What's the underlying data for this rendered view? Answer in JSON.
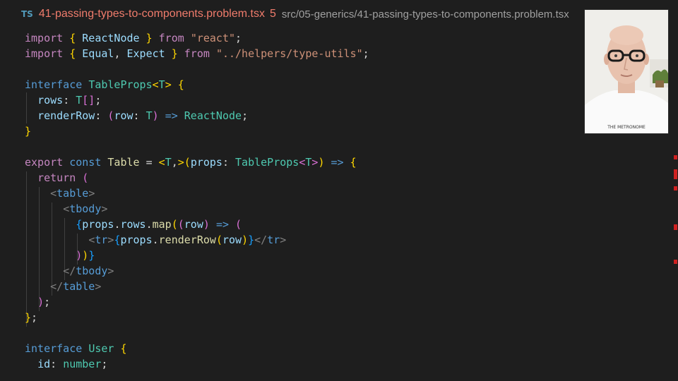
{
  "tab": {
    "language_badge": "TS",
    "filename": "41-passing-types-to-components.problem.tsx",
    "problem_count": "5",
    "path": "src/05-generics/41-passing-types-to-components.problem.tsx"
  },
  "code": {
    "l1": {
      "a": "import",
      "b": "{",
      "c": "ReactNode",
      "d": "}",
      "e": "from",
      "f": "\"react\"",
      "g": ";"
    },
    "l2": {
      "a": "import",
      "b": "{",
      "c": "Equal",
      "d": ",",
      "e": "Expect",
      "f": "}",
      "g": "from",
      "h": "\"../helpers/type-utils\"",
      "i": ";"
    },
    "l4": {
      "a": "interface",
      "b": "TableProps",
      "c": "<",
      "d": "T",
      "e": ">",
      "f": "{"
    },
    "l5": {
      "a": "rows",
      "b": ":",
      "c": "T",
      "d": "[]",
      "e": ";"
    },
    "l6": {
      "a": "renderRow",
      "b": ":",
      "c": "(",
      "d": "row",
      "e": ":",
      "f": "T",
      "g": ")",
      "h": "=>",
      "i": "ReactNode",
      "j": ";"
    },
    "l7": {
      "a": "}"
    },
    "l9": {
      "a": "export",
      "b": "const",
      "c": "Table",
      "d": "=",
      "e": "<",
      "f": "T",
      "g": ",",
      "h": ">",
      "i": "(",
      "j": "props",
      "k": ":",
      "l": "TableProps",
      "m": "<",
      "n": "T",
      "o": ">",
      "p": ")",
      "q": "=>",
      "r": "{"
    },
    "l10": {
      "a": "return",
      "b": "("
    },
    "l11": {
      "a": "<",
      "b": "table",
      "c": ">"
    },
    "l12": {
      "a": "<",
      "b": "tbody",
      "c": ">"
    },
    "l13": {
      "a": "{",
      "b": "props",
      "c": ".",
      "d": "rows",
      "e": ".",
      "f": "map",
      "g": "(",
      "h": "(",
      "i": "row",
      "j": ")",
      "k": "=>",
      "l": "("
    },
    "l14": {
      "a": "<",
      "b": "tr",
      "c": ">",
      "d": "{",
      "e": "props",
      "f": ".",
      "g": "renderRow",
      "h": "(",
      "i": "row",
      "j": ")",
      "k": "}",
      "l": "</",
      "m": "tr",
      "n": ">"
    },
    "l15": {
      "a": ")",
      "b": ")",
      "c": "}"
    },
    "l16": {
      "a": "</",
      "b": "tbody",
      "c": ">"
    },
    "l17": {
      "a": "</",
      "b": "table",
      "c": ">"
    },
    "l18": {
      "a": ")",
      "b": ";"
    },
    "l19": {
      "a": "}",
      "b": ";"
    },
    "l21": {
      "a": "interface",
      "b": "User",
      "c": "{"
    },
    "l22": {
      "a": "id",
      "b": ":",
      "c": "number",
      "d": ";"
    }
  },
  "webcam": {
    "shirt_text": "THE METRONOME"
  },
  "colors": {
    "background": "#1e1e1e",
    "keyword": "#c586c0",
    "type": "#4ec9b0",
    "variable": "#9cdcfe",
    "string": "#ce9178",
    "error": "#f07c6c"
  }
}
